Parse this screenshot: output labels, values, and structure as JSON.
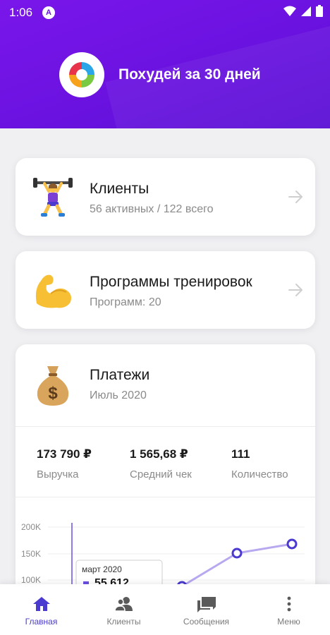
{
  "status": {
    "time": "1:06",
    "app_glyph": "A"
  },
  "header": {
    "title": "Похудей за 30 дней"
  },
  "cards": {
    "clients": {
      "title": "Клиенты",
      "subtitle": "56 активных / 122 всего",
      "icon": "weightlifter-icon"
    },
    "programs": {
      "title": "Программы тренировок",
      "subtitle": "Программ: 20",
      "icon": "flexed-biceps-icon"
    },
    "payments": {
      "title": "Платежи",
      "subtitle": "Июль 2020",
      "icon": "money-bag-icon"
    }
  },
  "stats": [
    {
      "value": "173 790 ₽",
      "label": "Выручка"
    },
    {
      "value": "1 565,68 ₽",
      "label": "Средний чек"
    },
    {
      "value": "111",
      "label": "Количество"
    }
  ],
  "chart_data": {
    "type": "line",
    "yticks": [
      "200K",
      "150K",
      "100K"
    ],
    "tooltip": {
      "label": "март 2020",
      "value": "55 612"
    },
    "series": [
      {
        "color": "#6a4fe0"
      }
    ]
  },
  "nav": [
    {
      "label": "Главная",
      "icon": "home-icon",
      "active": true
    },
    {
      "label": "Клиенты",
      "icon": "clients-icon",
      "active": false
    },
    {
      "label": "Сообщения",
      "icon": "messages-icon",
      "active": false
    },
    {
      "label": "Меню",
      "icon": "more-icon",
      "active": false
    }
  ],
  "colors": {
    "header": "#6a12e0",
    "accent": "#4a3ad0",
    "line": "#6a4fe0"
  }
}
